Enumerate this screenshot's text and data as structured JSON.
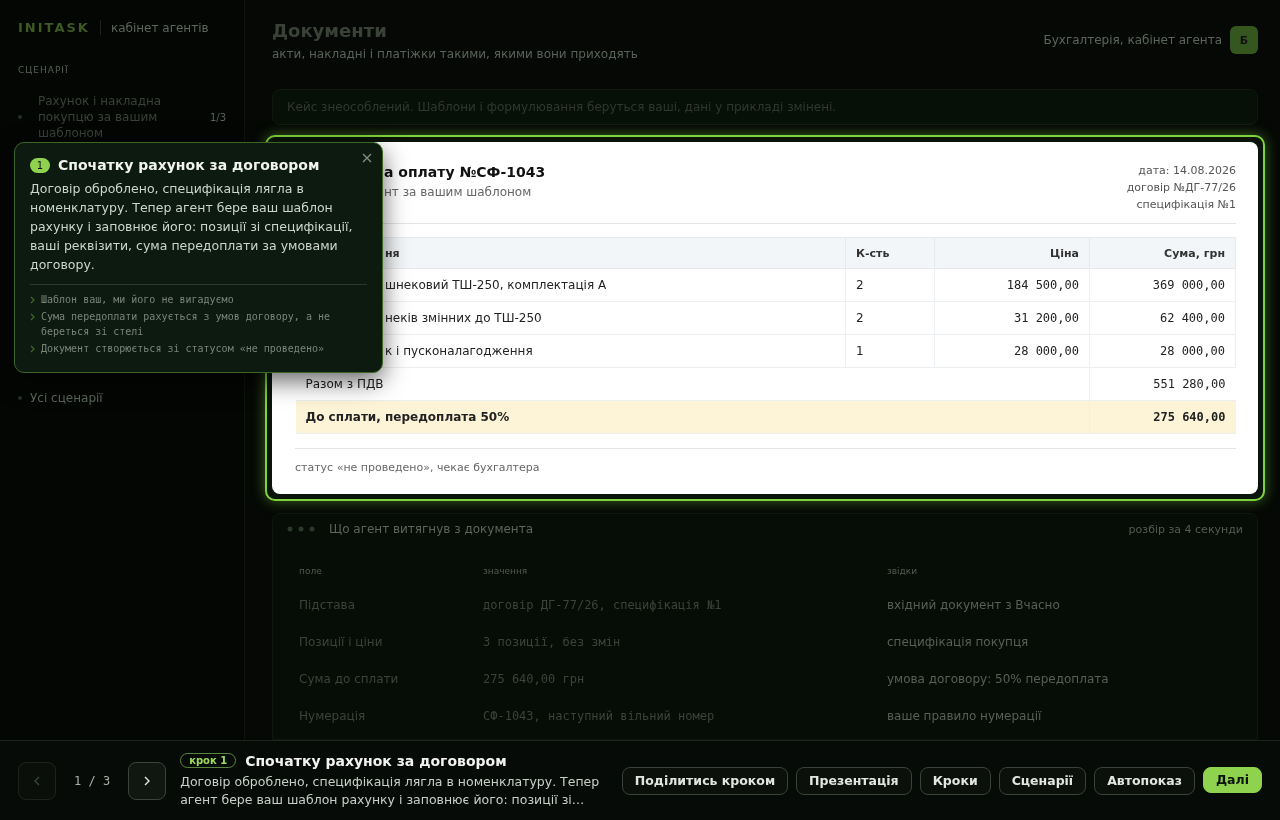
{
  "sidebar": {
    "brand": "INITASK",
    "brand_caption": "кабінет агентів",
    "section_title": "СЦЕНАРІЇ",
    "scenario": {
      "label": "Рахунок і накладна покупцю за вашим шаблоном",
      "count": "1/3"
    },
    "all_link": "Усі сценарії"
  },
  "header": {
    "title": "Документи",
    "subtitle": "акти, накладні і платіжки такими, якими вони приходять",
    "user": "Бухгалтерія, кабінет агента",
    "avatar": "Б"
  },
  "notice": "Кейс знеособлений. Шаблони і формулювання беруться ваші, дані у прикладі змінені.",
  "document": {
    "title": "а оплату №СФ-1043",
    "subtitle": "нт за вашим шаблоном",
    "meta": [
      "дата: 14.08.2026",
      "договір №ДГ-77/26",
      "специфікація №1"
    ],
    "columns": [
      "ня",
      "К-сть",
      "Ціна",
      "Сума, грн"
    ],
    "rows": [
      {
        "name": "шнековий ТШ-250, комплектація А",
        "qty": "2",
        "price": "184 500,00",
        "sum": "369 000,00"
      },
      {
        "name": "неків змінних до ТШ-250",
        "qty": "2",
        "price": "31 200,00",
        "sum": "62 400,00"
      },
      {
        "name": "к і пусконалагодження",
        "qty": "1",
        "price": "28 000,00",
        "sum": "28 000,00"
      }
    ],
    "totals": [
      {
        "label": "Разом з ПДВ",
        "value": "551 280,00",
        "emphasis": false
      },
      {
        "label": "До сплати, передоплата 50%",
        "value": "275 640,00",
        "emphasis": true
      }
    ],
    "status": "статус «не проведено», чекає бухгалтера"
  },
  "extraction": {
    "title": "Що агент витягнув з документа",
    "note": "розбір за 4 секунди",
    "columns": [
      "поле",
      "значення",
      "звідки"
    ],
    "rows": [
      {
        "field": "Підстава",
        "value": "договір ДГ-77/26, специфікація №1",
        "source": "вхідний документ з Вчасно"
      },
      {
        "field": "Позиції і ціни",
        "value": "3 позиції, без змін",
        "source": "специфікація покупця"
      },
      {
        "field": "Сума до сплати",
        "value": "275 640,00 грн",
        "source": "умова договору: 50% передоплата"
      },
      {
        "field": "Нумерація",
        "value": "СФ-1043, наступний вільний номер",
        "source": "ваше правило нумерації"
      }
    ]
  },
  "popover": {
    "step": "1",
    "title": "Спочатку рахунок за договором",
    "text": "Договір оброблено, специфікація лягла в номенклатуру. Тепер агент бере ваш шаблон рахунку і заповнює його: позиції зі специфікації, ваші реквізити, сума передоплати за умовами договору.",
    "points": [
      "Шаблон ваш, ми його не вигадуємо",
      "Сума передоплати рахується з умов договору, а не береться зі стелі",
      "Документ створюється зі статусом «не проведено»"
    ]
  },
  "tour_bar": {
    "prev_disabled": true,
    "next_disabled": false,
    "counter": "1 / 3",
    "step_badge": "крок 1",
    "title": "Спочатку рахунок за договором",
    "text": "Договір оброблено, специфікація лягла в номенклатуру. Тепер агент бере ваш шаблон рахунку і заповнює його: позиції зі…",
    "buttons": [
      {
        "label": "Поділитись кроком",
        "primary": false
      },
      {
        "label": "Презентація",
        "primary": false
      },
      {
        "label": "Кроки",
        "primary": false
      },
      {
        "label": "Сценарії",
        "primary": false
      },
      {
        "label": "Автопоказ",
        "primary": false
      },
      {
        "label": "Далі",
        "primary": true
      }
    ]
  }
}
